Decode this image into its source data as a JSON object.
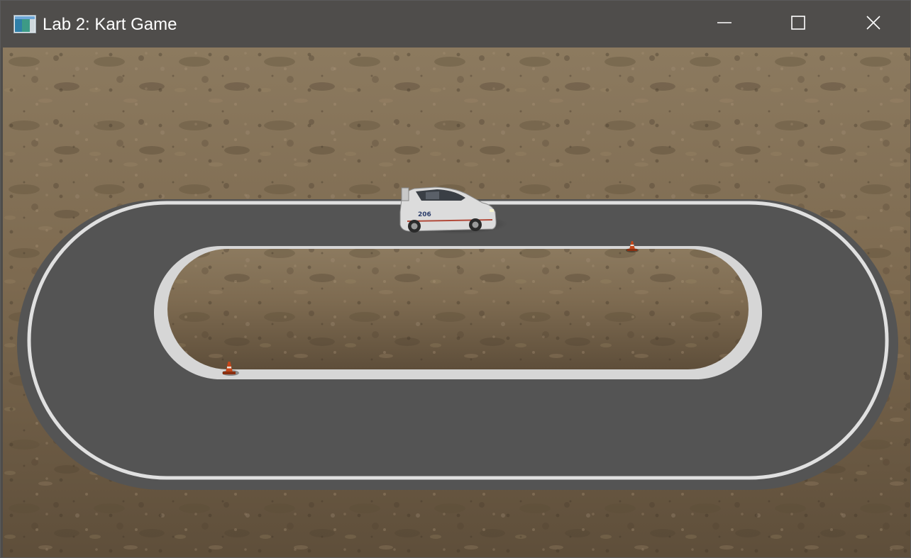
{
  "window": {
    "title": "Lab 2: Kart Game",
    "icon": "app-window-icon",
    "controls": {
      "minimize_icon": "minimize-icon",
      "maximize_icon": "maximize-icon",
      "close_icon": "close-icon"
    }
  },
  "scene": {
    "ground": "desert-dirt-terrain",
    "track": "oval-asphalt-track",
    "kart": "white-rally-car",
    "cones": [
      "traffic-cone",
      "traffic-cone"
    ],
    "colors": {
      "dirt": "#7e6a4f",
      "dirt_dark": "#5c4b36",
      "asphalt": "#545454",
      "track_line": "#e2e2e2",
      "titlebar": "#4f4d4b",
      "cone": "#c4471a"
    }
  }
}
